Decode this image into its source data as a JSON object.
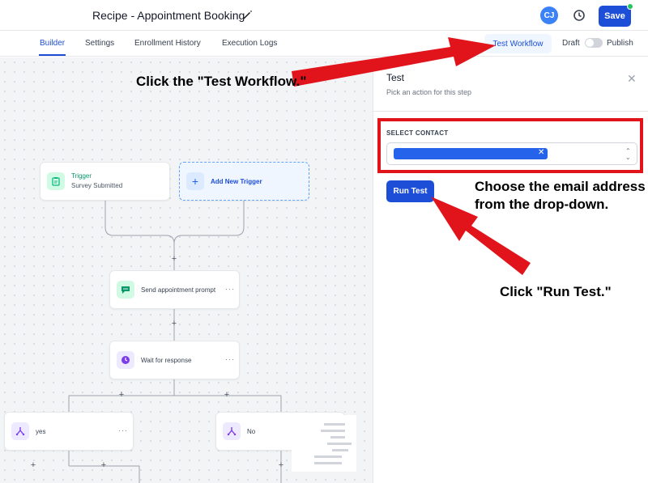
{
  "header": {
    "title": "Recipe - Appointment Booking",
    "avatar_initials": "CJ",
    "save_label": "Save"
  },
  "tabs": [
    {
      "label": "Builder",
      "active": true
    },
    {
      "label": "Settings"
    },
    {
      "label": "Enrollment History"
    },
    {
      "label": "Execution Logs"
    }
  ],
  "toolbar": {
    "test_workflow_label": "Test Workflow",
    "draft_label": "Draft",
    "publish_label": "Publish"
  },
  "canvas": {
    "trigger": {
      "title": "Trigger",
      "subtitle": "Survey Submitted"
    },
    "add_trigger": "Add New Trigger",
    "send_prompt": "Send appointment prompt",
    "wait": "Wait for response",
    "branch_yes": "yes",
    "branch_no": "No"
  },
  "panel": {
    "title": "Test",
    "subtitle": "Pick an action for this step",
    "select_contact_label": "SELECT CONTACT",
    "run_test_label": "Run Test"
  },
  "annotations": {
    "click_test_workflow": "Click the \"Test Workflow.\"",
    "choose_email_line1": "Choose the email address",
    "choose_email_line2": "from the drop-down.",
    "click_run_test": "Click \"Run Test.\""
  },
  "colors": {
    "accent": "#1d4ed8",
    "annotation_red": "#e1141c",
    "trigger_icon": "#10b981",
    "message_icon": "#059669",
    "wait_icon": "#7c3aed",
    "branch_icon": "#7c3aed"
  }
}
